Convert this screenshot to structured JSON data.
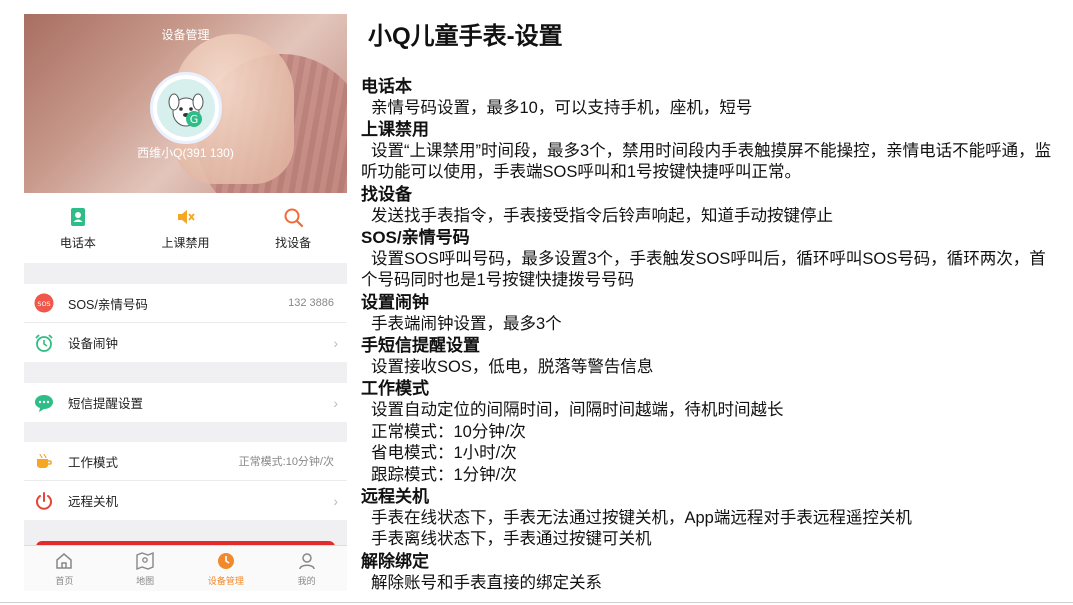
{
  "phone": {
    "hero_title": "设备管理",
    "device_name": "西维小Q(391          130)",
    "quick_actions": [
      {
        "label": "电话本",
        "icon": "phonebook-icon",
        "color": "#2ebd86"
      },
      {
        "label": "上课禁用",
        "icon": "mute-icon",
        "color": "#f5a623"
      },
      {
        "label": "找设备",
        "icon": "search-icon",
        "color": "#f26b3a"
      }
    ],
    "group1": [
      {
        "label": "SOS/亲情号码",
        "value": "132        3886",
        "icon": "sos-icon"
      },
      {
        "label": "设备闹钟",
        "value": "",
        "icon": "alarm-icon"
      }
    ],
    "group2": [
      {
        "label": "短信提醒设置",
        "value": "",
        "icon": "message-icon"
      }
    ],
    "group3": [
      {
        "label": "工作模式",
        "value": "正常模式:10分钟/次",
        "icon": "cup-icon"
      },
      {
        "label": "远程关机",
        "value": "",
        "icon": "power-icon"
      }
    ],
    "tabs": [
      {
        "label": "首页",
        "icon": "home-icon"
      },
      {
        "label": "地图",
        "icon": "map-icon"
      },
      {
        "label": "设备管理",
        "icon": "device-icon",
        "active": true
      },
      {
        "label": "我的",
        "icon": "user-icon"
      }
    ],
    "colors": {
      "accent": "#f08a2c",
      "green": "#2ebd86",
      "red": "#e42b2b",
      "orange": "#f26b3a"
    }
  },
  "doc": {
    "title": "小Q儿童手表-设置",
    "sections": [
      {
        "heading": "电话本",
        "lines": [
          "亲情号码设置，最多10，可以支持手机，座机，短号"
        ]
      },
      {
        "heading": "上课禁用",
        "lines": [
          "设置“上课禁用”时间段，最多3个，禁用时间段内手表触摸屏不能操控，亲情电话不能呼通，监听功能可以使用，手表端SOS呼叫和1号按键快捷呼叫正常。"
        ]
      },
      {
        "heading": "找设备",
        "lines": [
          "发送找手表指令，手表接受指令后铃声响起，知道手动按键停止"
        ]
      },
      {
        "heading": "SOS/亲情号码",
        "lines": [
          "设置SOS呼叫号码，最多设置3个，手表触发SOS呼叫后，循环呼叫SOS号码，循环两次，首个号码同时也是1号按键快捷拨号号码"
        ]
      },
      {
        "heading": "设置闹钟",
        "lines": [
          "手表端闹钟设置，最多3个"
        ]
      },
      {
        "heading": "手短信提醒设置",
        "lines": [
          "设置接收SOS，低电，脱落等警告信息"
        ]
      },
      {
        "heading": "工作模式",
        "lines": [
          "设置自动定位的间隔时间，间隔时间越端，待机时间越长",
          "正常模式：10分钟/次",
          "省电模式：1小时/次",
          "跟踪模式：1分钟/次"
        ]
      },
      {
        "heading": "远程关机",
        "lines": [
          "手表在线状态下，手表无法通过按键关机，App端远程对手表远程遥控关机",
          "手表离线状态下，手表通过按键可关机"
        ]
      },
      {
        "heading": "解除绑定",
        "lines": [
          "解除账号和手表直接的绑定关系"
        ]
      }
    ]
  }
}
